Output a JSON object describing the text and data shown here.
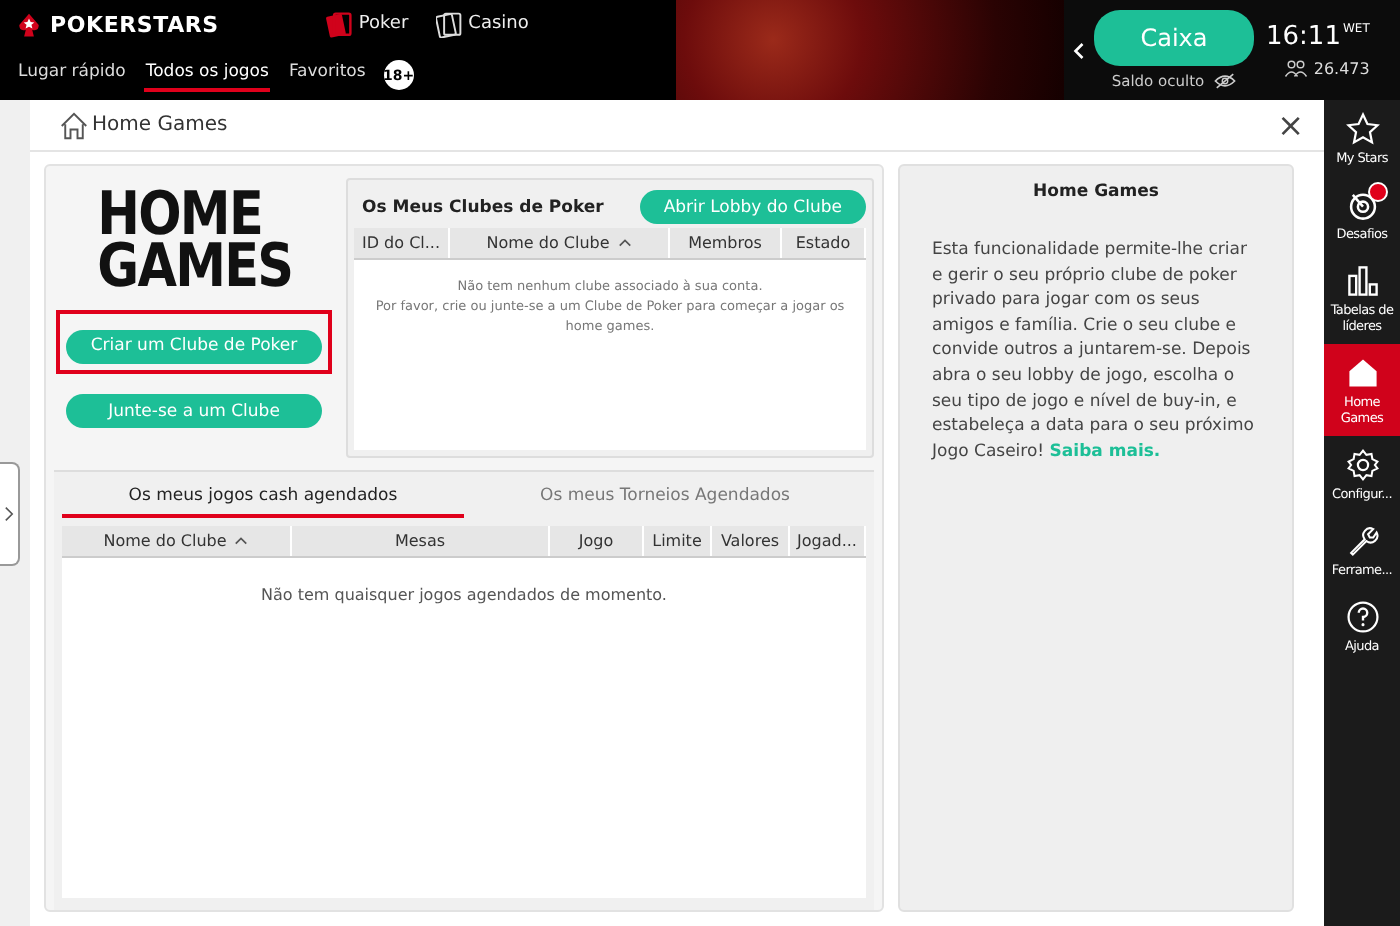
{
  "top_bar": {
    "brand": "POKERSTARS",
    "products": [
      {
        "label": "Poker",
        "kind": "poker"
      },
      {
        "label": "Casino",
        "kind": "casino"
      }
    ],
    "nav": [
      {
        "label": "Lugar rápido",
        "selected": false
      },
      {
        "label": "Todos os jogos",
        "selected": true
      },
      {
        "label": "Favoritos",
        "selected": false
      }
    ],
    "age_badge": "18+",
    "cashier_button": "Caixa",
    "balance": "Saldo oculto",
    "time": "16:11",
    "timezone": "WET",
    "players_online": "26.473"
  },
  "window": {
    "title": "Home Games",
    "close": "×"
  },
  "logo": [
    "HOME",
    "GAMES"
  ],
  "actions": [
    {
      "label": "Criar um Clube de Poker",
      "highlighted": true
    },
    {
      "label": "Junte-se a um Clube",
      "highlighted": false
    }
  ],
  "clubs": {
    "title": "Os Meus Clubes de Poker",
    "open_button": "Abrir Lobby do Clube",
    "columns": [
      {
        "label": "ID do Cl...",
        "sorted": false
      },
      {
        "label": "Nome do Clube",
        "sorted": true
      },
      {
        "label": "Membros",
        "sorted": false
      },
      {
        "label": "Estado",
        "sorted": false
      }
    ],
    "empty_lines": [
      "Não tem nenhum clube associado à sua conta.",
      "Por favor, crie ou junte-se a um Clube de Poker para começar a jogar os home games."
    ]
  },
  "scheduled": {
    "tabs": [
      {
        "label": "Os meus jogos cash agendados",
        "selected": true
      },
      {
        "label": "Os meus Torneios Agendados",
        "selected": false
      }
    ],
    "columns": [
      {
        "label": "Nome do Clube",
        "sorted": true
      },
      {
        "label": "Mesas",
        "sorted": false
      },
      {
        "label": "Jogo",
        "sorted": false
      },
      {
        "label": "Limite",
        "sorted": false
      },
      {
        "label": "Valores",
        "sorted": false
      },
      {
        "label": "Jogad...",
        "sorted": false
      }
    ],
    "empty": "Não tem quaisquer jogos agendados de momento."
  },
  "info": {
    "title": "Home Games",
    "text": "Esta funcionalidade permite-lhe criar e gerir o seu próprio clube de poker privado para jogar com os seus amigos e família. Crie o seu clube e convide outros a juntarem-se. Depois abra o seu lobby de jogo, escolha o seu tipo de jogo e nível de buy-in, e estabeleça a data para o seu próximo Jogo Caseiro!",
    "link": "Saiba mais."
  },
  "sidebar": [
    {
      "label": "My Stars",
      "kind": "star",
      "selected": false,
      "alert": false
    },
    {
      "label": "Desafios",
      "kind": "target",
      "selected": false,
      "alert": true
    },
    {
      "label": "Tabelas de líderes",
      "kind": "bars",
      "selected": false,
      "alert": false
    },
    {
      "label": "Home Games",
      "kind": "home",
      "selected": true,
      "alert": false
    },
    {
      "label": "Configur...",
      "kind": "gear",
      "selected": false,
      "alert": false
    },
    {
      "label": "Ferrame...",
      "kind": "wrench",
      "selected": false,
      "alert": false
    },
    {
      "label": "Ajuda",
      "kind": "help",
      "selected": false,
      "alert": false
    }
  ]
}
